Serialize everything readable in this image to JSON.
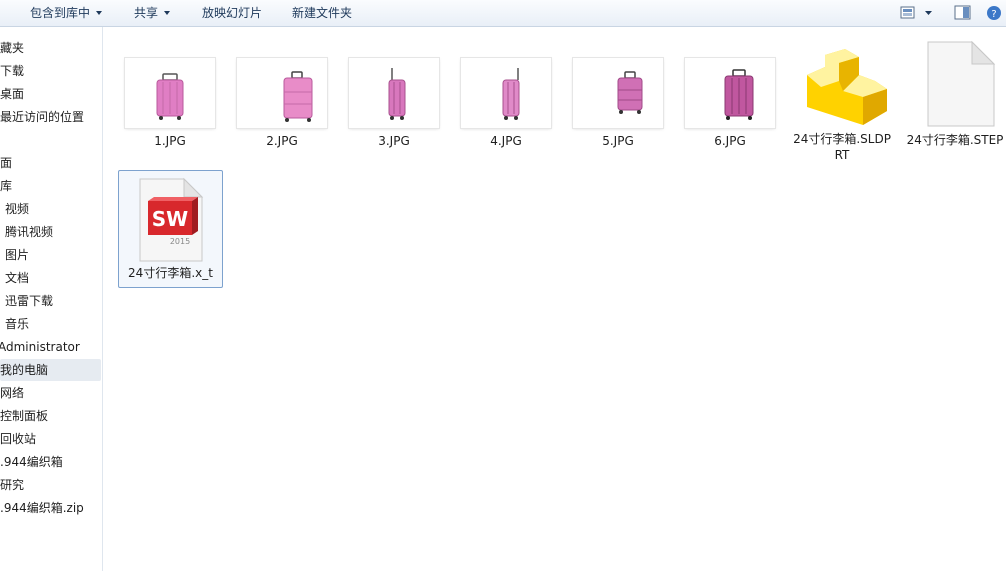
{
  "toolbar": {
    "include_library": "包含到库中",
    "share": "共享",
    "slideshow": "放映幻灯片",
    "new_folder": "新建文件夹"
  },
  "nav": {
    "items": [
      {
        "label": "藏夹"
      },
      {
        "label": "下载"
      },
      {
        "label": "桌面"
      },
      {
        "label": "最近访问的位置"
      },
      {
        "label": "面"
      },
      {
        "label": "库"
      },
      {
        "label": "视频"
      },
      {
        "label": "腾讯视频"
      },
      {
        "label": "图片"
      },
      {
        "label": "文档"
      },
      {
        "label": "迅雷下载"
      },
      {
        "label": "音乐"
      },
      {
        "label": "Administrator"
      },
      {
        "label": "我的电脑"
      },
      {
        "label": "网络"
      },
      {
        "label": "控制面板"
      },
      {
        "label": "回收站"
      },
      {
        "label": ".944编织箱"
      },
      {
        "label": "研究"
      },
      {
        "label": ".944编织箱.zip"
      }
    ]
  },
  "files": [
    {
      "name": "1.JPG"
    },
    {
      "name": "2.JPG"
    },
    {
      "name": "3.JPG"
    },
    {
      "name": "4.JPG"
    },
    {
      "name": "5.JPG"
    },
    {
      "name": "6.JPG"
    },
    {
      "name": "24寸行李箱.SLDPRT"
    },
    {
      "name": "24寸行李箱.STEP"
    },
    {
      "name": "24寸行李箱.x_t"
    }
  ],
  "sw_icon": {
    "letters": "SW",
    "version": "2015"
  },
  "colors": {
    "accent": "#1e395b",
    "selection": "#e6ebf1",
    "sw_red": "#d8282c",
    "luggage_pink": "#e07ec4"
  }
}
